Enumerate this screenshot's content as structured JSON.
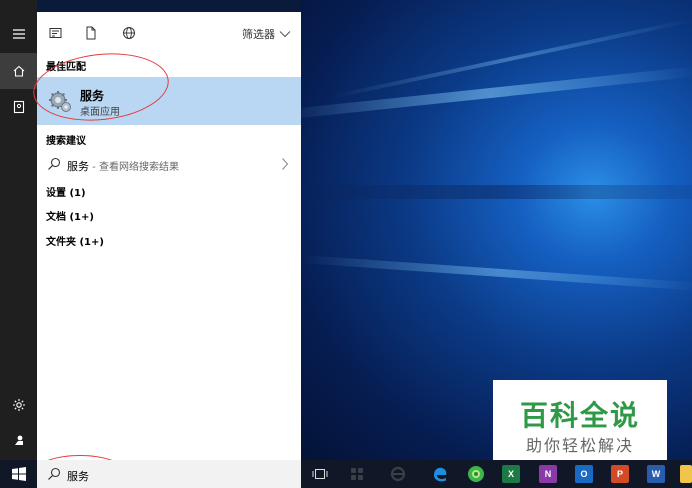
{
  "panel": {
    "filter_label": "筛选器",
    "best_match_heading": "最佳匹配",
    "best_match": {
      "title": "服务",
      "subtitle": "桌面应用"
    },
    "suggestions_heading": "搜索建议",
    "suggestion": {
      "query": "服务",
      "hint": " - 查看网络搜索结果"
    },
    "items": [
      {
        "label": "设置 (1)"
      },
      {
        "label": "文档 (1+)"
      },
      {
        "label": "文件夹 (1+)"
      }
    ]
  },
  "search": {
    "value": "服务"
  },
  "watermark": {
    "main": "百科全说",
    "sub": "助你轻松解决"
  },
  "taskbar": {
    "apps": [
      {
        "name": "task-view",
        "label": ""
      },
      {
        "name": "store",
        "label": ""
      },
      {
        "name": "edge-old",
        "label": ""
      },
      {
        "name": "edge",
        "label": "e"
      },
      {
        "name": "browser-green",
        "label": ""
      },
      {
        "name": "excel",
        "label": "X"
      },
      {
        "name": "onenote",
        "label": "N"
      },
      {
        "name": "outlook",
        "label": "O"
      },
      {
        "name": "powerpoint",
        "label": "P"
      },
      {
        "name": "word",
        "label": "W"
      }
    ]
  },
  "colors": {
    "highlight": "#b9d7f2",
    "rail": "#1f1f1f",
    "annotation": "#e23b3b",
    "watermark_green": "#2f9a45"
  }
}
